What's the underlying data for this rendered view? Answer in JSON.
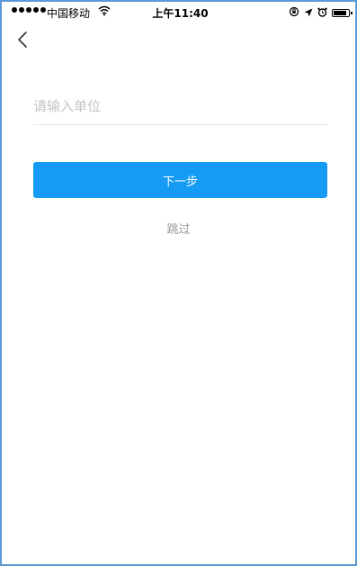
{
  "status_bar": {
    "carrier": "中国移动",
    "time": "上午11:40",
    "signal_icon": "signal-dots-icon",
    "wifi_icon": "wifi-icon",
    "right_icons": [
      "orientation-lock-icon",
      "location-arrow-icon",
      "alarm-icon",
      "battery-icon"
    ]
  },
  "nav": {
    "back_icon": "chevron-left-icon"
  },
  "form": {
    "unit_placeholder": "请输入单位",
    "unit_value": "",
    "next_label": "下一步",
    "skip_label": "跳过"
  },
  "colors": {
    "primary": "#169bf5",
    "placeholder": "#c4c4c4",
    "skip_text": "#9a9a9a",
    "divider": "#e6e6e6",
    "frame_border": "#5b9bd5"
  }
}
